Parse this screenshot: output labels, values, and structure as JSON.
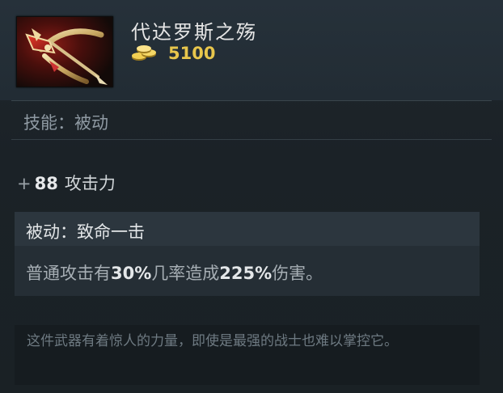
{
  "item": {
    "name": "代达罗斯之殇",
    "price": "5100",
    "icon": "daedalus-crossbow-icon",
    "currency_icon": "gold-coins-icon"
  },
  "ability": {
    "type_label": "技能：被动"
  },
  "stats": [
    {
      "sign": "+",
      "value": "88",
      "name": "攻击力"
    }
  ],
  "passive": {
    "title": "被动：致命一击",
    "desc_pre": "普通攻击有",
    "chance": "30%",
    "desc_mid": "几率造成",
    "damage": "225%",
    "desc_post": "伤害。"
  },
  "lore": "这件武器有着惊人的力量，即使是最强的战士也难以掌控它。",
  "colors": {
    "gold": "#e8c64c",
    "background": "#1b2228"
  }
}
